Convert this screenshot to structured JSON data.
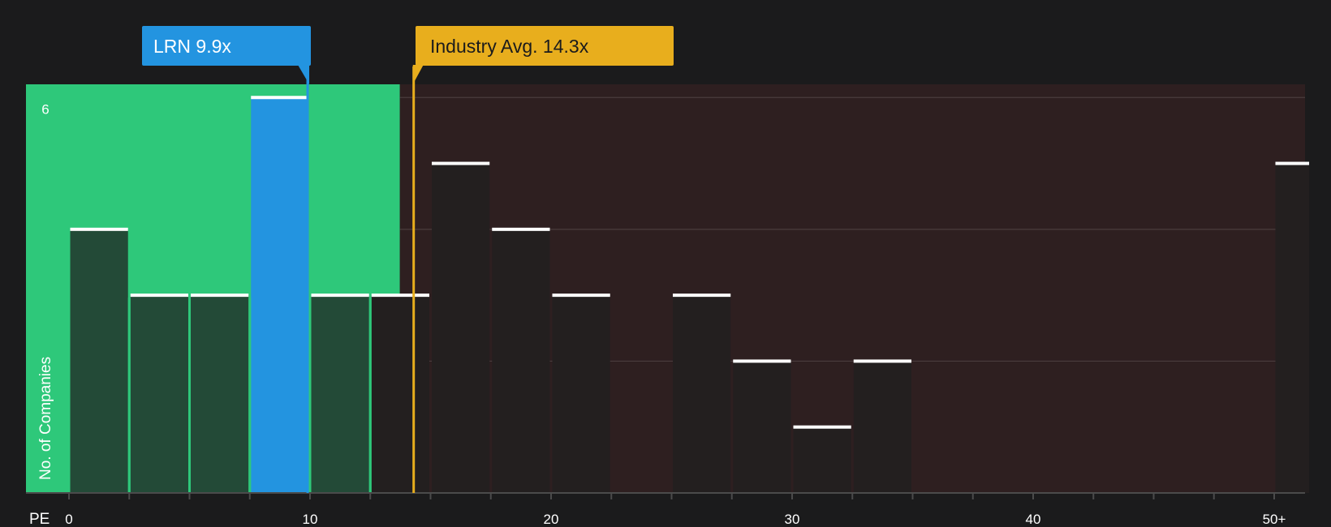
{
  "chart_data": {
    "type": "bar",
    "title": "",
    "xlabel": "PE",
    "ylabel": "No. of Companies",
    "xlim": [
      0,
      51.5
    ],
    "ylim": [
      0,
      6.2
    ],
    "y_gridlines": [
      2,
      4,
      6
    ],
    "x_ticks": [
      {
        "value": 0,
        "label": "0"
      },
      {
        "value": 10,
        "label": "10"
      },
      {
        "value": 20,
        "label": "20"
      },
      {
        "value": 30,
        "label": "30"
      },
      {
        "value": 40,
        "label": "40"
      },
      {
        "value": 50,
        "label": "50+"
      }
    ],
    "y_ticks": [
      {
        "value": 6,
        "label": "6"
      }
    ],
    "bin_width": 2.5,
    "bars": [
      {
        "x0": 0,
        "x1": 2.5,
        "value": 4
      },
      {
        "x0": 2.5,
        "x1": 5,
        "value": 3
      },
      {
        "x0": 5,
        "x1": 7.5,
        "value": 3
      },
      {
        "x0": 7.5,
        "x1": 10,
        "value": 6,
        "highlight": true
      },
      {
        "x0": 10,
        "x1": 12.5,
        "value": 3
      },
      {
        "x0": 12.5,
        "x1": 15,
        "value": 3
      },
      {
        "x0": 15,
        "x1": 17.5,
        "value": 5
      },
      {
        "x0": 17.5,
        "x1": 20,
        "value": 4
      },
      {
        "x0": 20,
        "x1": 22.5,
        "value": 3
      },
      {
        "x0": 25,
        "x1": 27.5,
        "value": 3
      },
      {
        "x0": 27.5,
        "x1": 30,
        "value": 2
      },
      {
        "x0": 30,
        "x1": 32.5,
        "value": 1
      },
      {
        "x0": 32.5,
        "x1": 35,
        "value": 2
      },
      {
        "x0": 50,
        "x1": 51.5,
        "value": 5
      }
    ],
    "company": {
      "label": "LRN 9.9x",
      "value": 9.9
    },
    "industry": {
      "label": "Industry Avg. 14.3x",
      "value": 14.3
    },
    "colors": {
      "background": "#1b1b1c",
      "undervalued_zone": "#2ec87a",
      "overvalued_zone": "#2e1f20",
      "bar_in_zone": "#234a37",
      "bar_out_zone": "#231f1f",
      "highlight_bar": "#2394e0",
      "bar_cap": "#ffffff",
      "company_marker": "#2394e0",
      "industry_marker": "#e8ae1d",
      "gridline": "#4a3c3d",
      "axis": "#4b4b4b"
    }
  }
}
